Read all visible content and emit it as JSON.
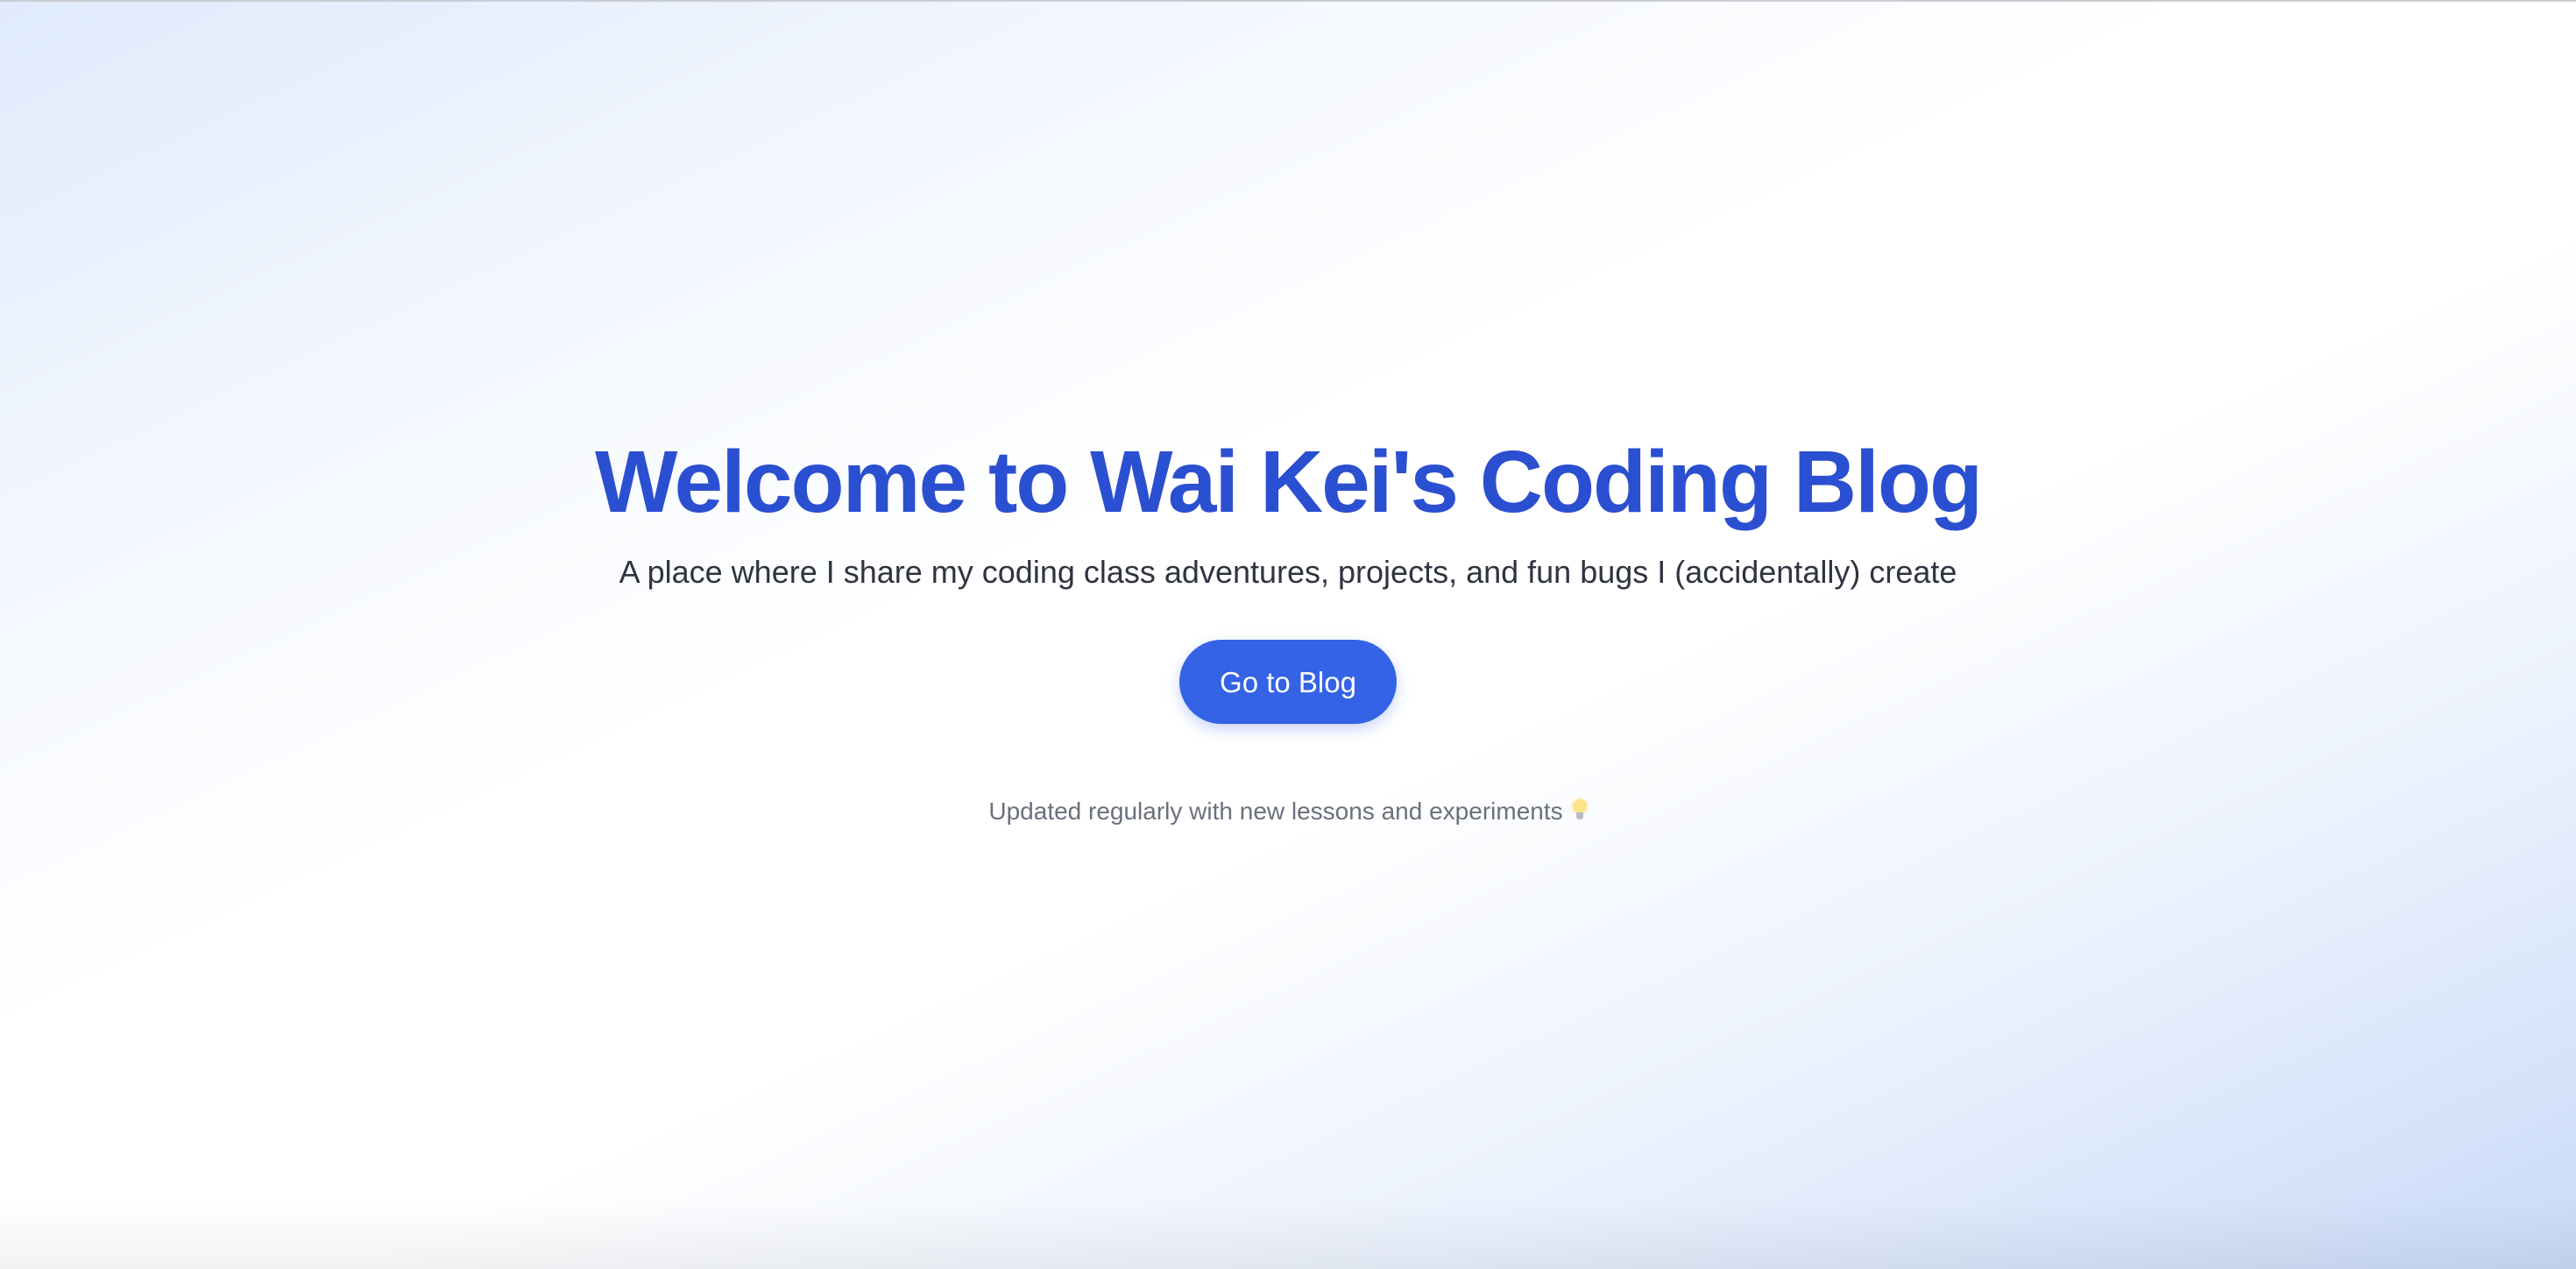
{
  "hero": {
    "title": "Welcome to Wai Kei's Coding Blog",
    "subtitle": "A place where I share my coding class adventures, projects, and fun bugs I (accidentally) create",
    "cta_label": "Go to Blog",
    "footnote": "Updated regularly with new lessons and experiments",
    "footnote_icon": "lightbulb-icon"
  },
  "colors": {
    "title": "#2b4fd1",
    "button": "#3563e6",
    "subtitle_text": "#2f3440",
    "footnote_text": "#6a707c"
  }
}
